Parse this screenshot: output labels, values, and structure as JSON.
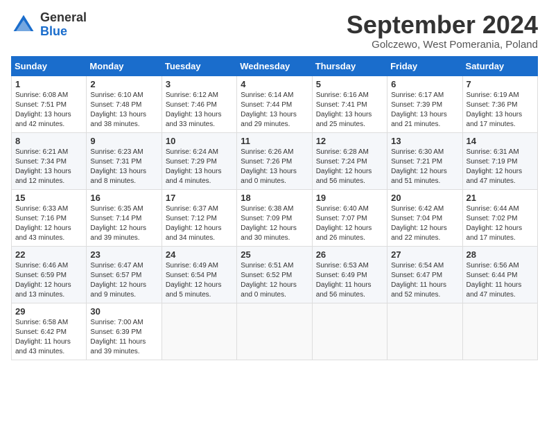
{
  "logo": {
    "general": "General",
    "blue": "Blue"
  },
  "title": "September 2024",
  "subtitle": "Golczewo, West Pomerania, Poland",
  "headers": [
    "Sunday",
    "Monday",
    "Tuesday",
    "Wednesday",
    "Thursday",
    "Friday",
    "Saturday"
  ],
  "weeks": [
    [
      {
        "day": "1",
        "info": "Sunrise: 6:08 AM\nSunset: 7:51 PM\nDaylight: 13 hours\nand 42 minutes."
      },
      {
        "day": "2",
        "info": "Sunrise: 6:10 AM\nSunset: 7:48 PM\nDaylight: 13 hours\nand 38 minutes."
      },
      {
        "day": "3",
        "info": "Sunrise: 6:12 AM\nSunset: 7:46 PM\nDaylight: 13 hours\nand 33 minutes."
      },
      {
        "day": "4",
        "info": "Sunrise: 6:14 AM\nSunset: 7:44 PM\nDaylight: 13 hours\nand 29 minutes."
      },
      {
        "day": "5",
        "info": "Sunrise: 6:16 AM\nSunset: 7:41 PM\nDaylight: 13 hours\nand 25 minutes."
      },
      {
        "day": "6",
        "info": "Sunrise: 6:17 AM\nSunset: 7:39 PM\nDaylight: 13 hours\nand 21 minutes."
      },
      {
        "day": "7",
        "info": "Sunrise: 6:19 AM\nSunset: 7:36 PM\nDaylight: 13 hours\nand 17 minutes."
      }
    ],
    [
      {
        "day": "8",
        "info": "Sunrise: 6:21 AM\nSunset: 7:34 PM\nDaylight: 13 hours\nand 12 minutes."
      },
      {
        "day": "9",
        "info": "Sunrise: 6:23 AM\nSunset: 7:31 PM\nDaylight: 13 hours\nand 8 minutes."
      },
      {
        "day": "10",
        "info": "Sunrise: 6:24 AM\nSunset: 7:29 PM\nDaylight: 13 hours\nand 4 minutes."
      },
      {
        "day": "11",
        "info": "Sunrise: 6:26 AM\nSunset: 7:26 PM\nDaylight: 13 hours\nand 0 minutes."
      },
      {
        "day": "12",
        "info": "Sunrise: 6:28 AM\nSunset: 7:24 PM\nDaylight: 12 hours\nand 56 minutes."
      },
      {
        "day": "13",
        "info": "Sunrise: 6:30 AM\nSunset: 7:21 PM\nDaylight: 12 hours\nand 51 minutes."
      },
      {
        "day": "14",
        "info": "Sunrise: 6:31 AM\nSunset: 7:19 PM\nDaylight: 12 hours\nand 47 minutes."
      }
    ],
    [
      {
        "day": "15",
        "info": "Sunrise: 6:33 AM\nSunset: 7:16 PM\nDaylight: 12 hours\nand 43 minutes."
      },
      {
        "day": "16",
        "info": "Sunrise: 6:35 AM\nSunset: 7:14 PM\nDaylight: 12 hours\nand 39 minutes."
      },
      {
        "day": "17",
        "info": "Sunrise: 6:37 AM\nSunset: 7:12 PM\nDaylight: 12 hours\nand 34 minutes."
      },
      {
        "day": "18",
        "info": "Sunrise: 6:38 AM\nSunset: 7:09 PM\nDaylight: 12 hours\nand 30 minutes."
      },
      {
        "day": "19",
        "info": "Sunrise: 6:40 AM\nSunset: 7:07 PM\nDaylight: 12 hours\nand 26 minutes."
      },
      {
        "day": "20",
        "info": "Sunrise: 6:42 AM\nSunset: 7:04 PM\nDaylight: 12 hours\nand 22 minutes."
      },
      {
        "day": "21",
        "info": "Sunrise: 6:44 AM\nSunset: 7:02 PM\nDaylight: 12 hours\nand 17 minutes."
      }
    ],
    [
      {
        "day": "22",
        "info": "Sunrise: 6:46 AM\nSunset: 6:59 PM\nDaylight: 12 hours\nand 13 minutes."
      },
      {
        "day": "23",
        "info": "Sunrise: 6:47 AM\nSunset: 6:57 PM\nDaylight: 12 hours\nand 9 minutes."
      },
      {
        "day": "24",
        "info": "Sunrise: 6:49 AM\nSunset: 6:54 PM\nDaylight: 12 hours\nand 5 minutes."
      },
      {
        "day": "25",
        "info": "Sunrise: 6:51 AM\nSunset: 6:52 PM\nDaylight: 12 hours\nand 0 minutes."
      },
      {
        "day": "26",
        "info": "Sunrise: 6:53 AM\nSunset: 6:49 PM\nDaylight: 11 hours\nand 56 minutes."
      },
      {
        "day": "27",
        "info": "Sunrise: 6:54 AM\nSunset: 6:47 PM\nDaylight: 11 hours\nand 52 minutes."
      },
      {
        "day": "28",
        "info": "Sunrise: 6:56 AM\nSunset: 6:44 PM\nDaylight: 11 hours\nand 47 minutes."
      }
    ],
    [
      {
        "day": "29",
        "info": "Sunrise: 6:58 AM\nSunset: 6:42 PM\nDaylight: 11 hours\nand 43 minutes."
      },
      {
        "day": "30",
        "info": "Sunrise: 7:00 AM\nSunset: 6:39 PM\nDaylight: 11 hours\nand 39 minutes."
      },
      {
        "day": "",
        "info": ""
      },
      {
        "day": "",
        "info": ""
      },
      {
        "day": "",
        "info": ""
      },
      {
        "day": "",
        "info": ""
      },
      {
        "day": "",
        "info": ""
      }
    ]
  ]
}
